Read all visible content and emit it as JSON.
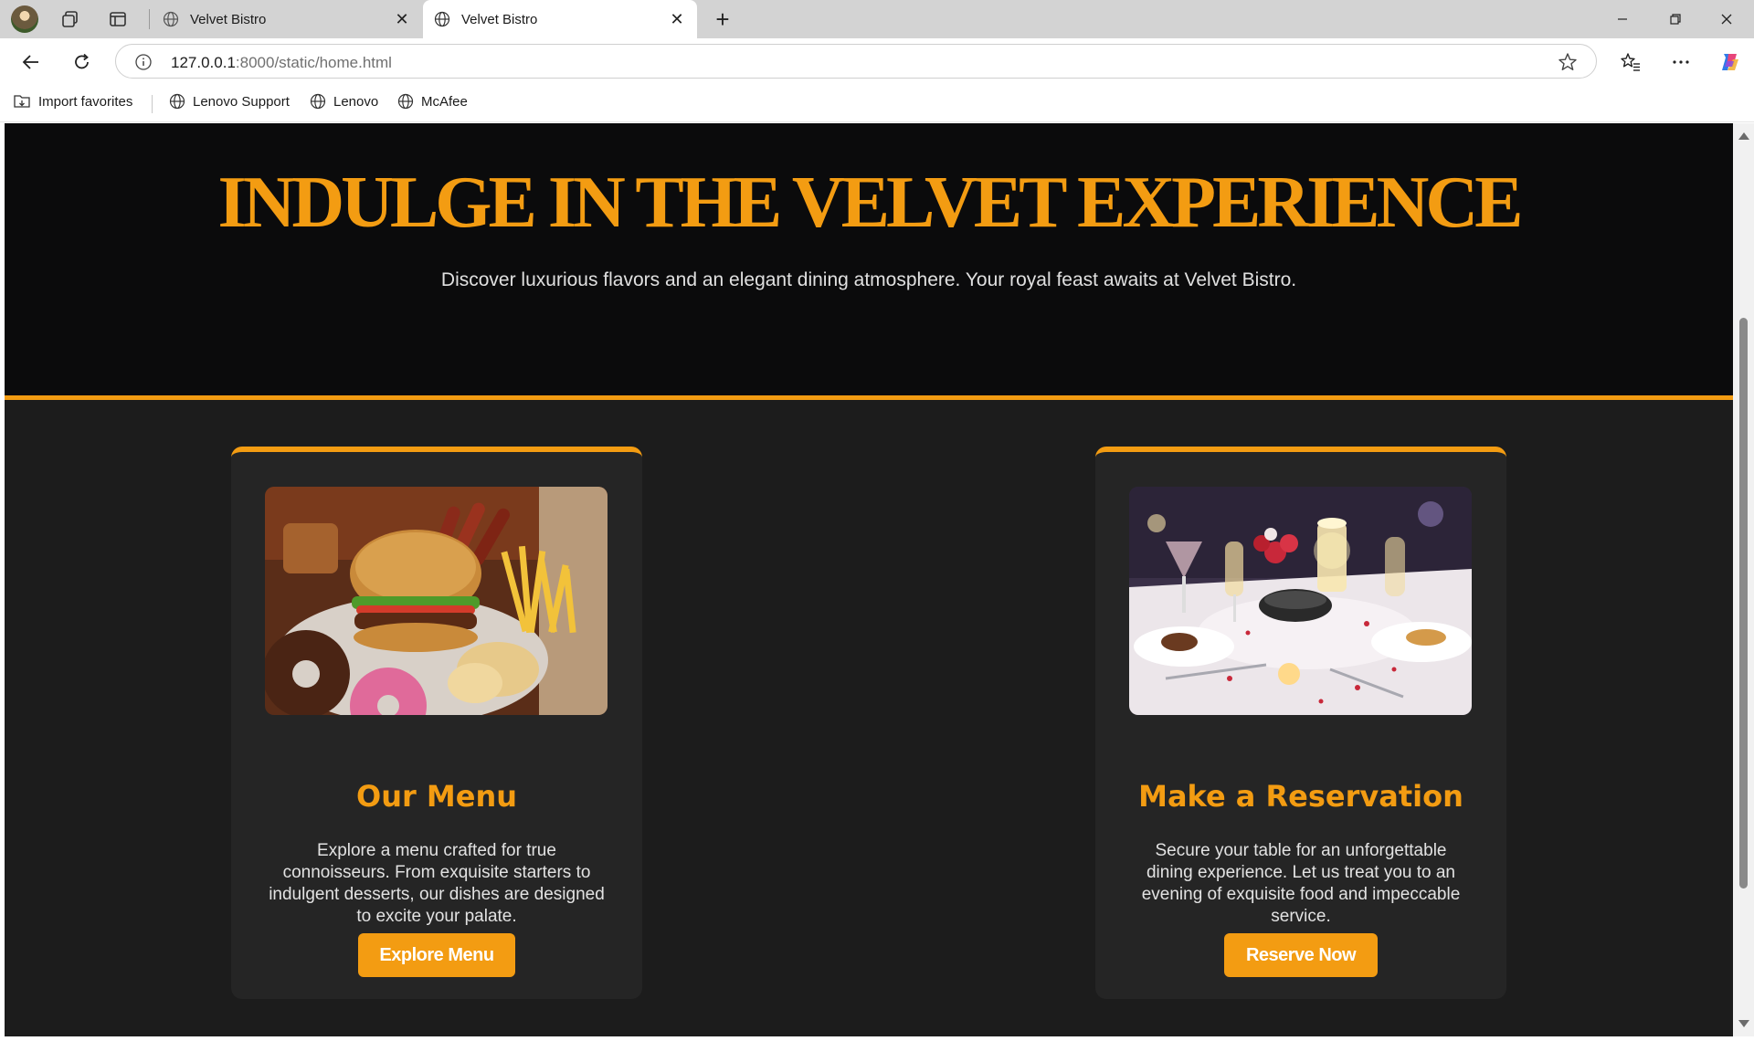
{
  "browser": {
    "tabs": [
      {
        "title": "Velvet Bistro",
        "active": false
      },
      {
        "title": "Velvet Bistro",
        "active": true
      }
    ],
    "url_host": "127.0.0.1",
    "url_rest": ":8000/static/home.html",
    "favorites": [
      "Import favorites",
      "Lenovo Support",
      "Lenovo",
      "McAfee"
    ]
  },
  "hero": {
    "title": "INDULGE IN THE VELVET EXPERIENCE",
    "subtitle": "Discover luxurious flavors and an elegant dining atmosphere. Your royal feast awaits at Velvet Bistro."
  },
  "cards": [
    {
      "title": "Our Menu",
      "text": "Explore a menu crafted for true connoisseurs. From exquisite starters to indulgent desserts, our dishes are designed to excite your palate.",
      "button": "Explore Menu",
      "image": "food-platter"
    },
    {
      "title": "Make a Reservation",
      "text": "Secure your table for an unforgettable dining experience. Let us treat you to an evening of exquisite food and impeccable service.",
      "button": "Reserve Now",
      "image": "candlelit-table"
    }
  ],
  "colors": {
    "accent": "#f39c12",
    "hero_bg": "#0b0b0c",
    "page_bg": "#1c1c1c",
    "card_bg": "#252525"
  }
}
